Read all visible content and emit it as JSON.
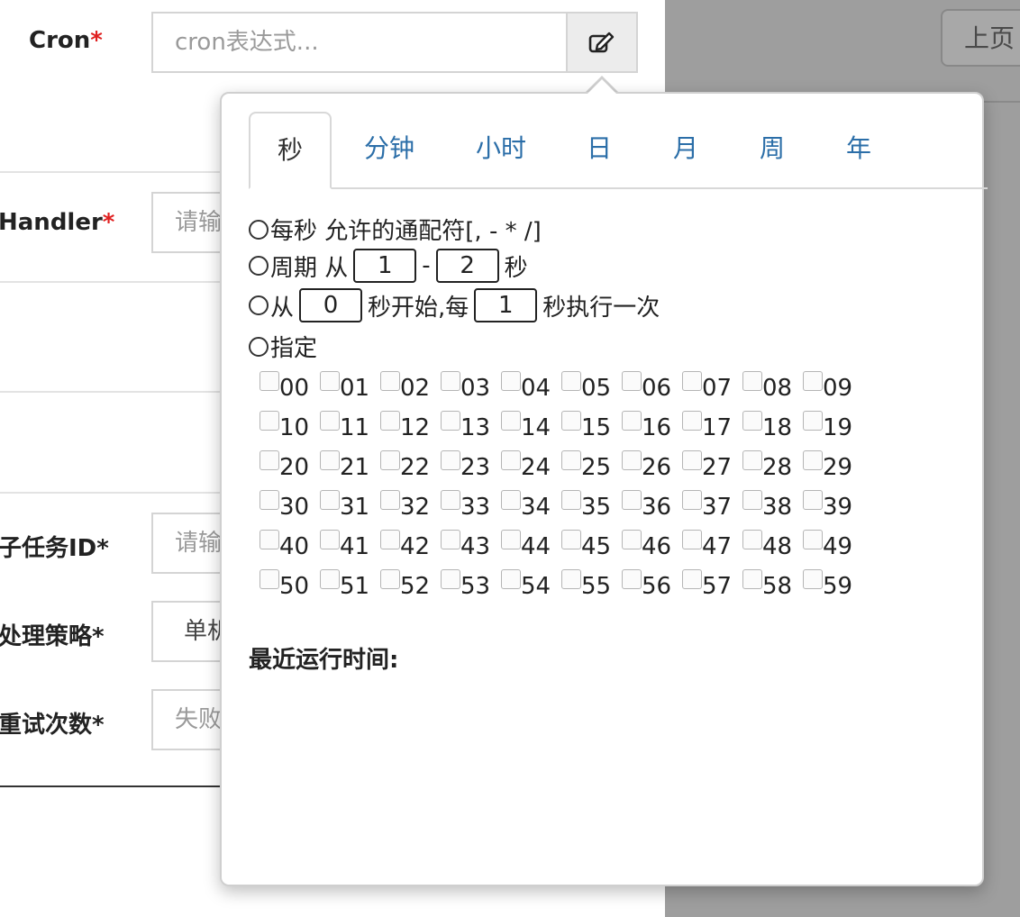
{
  "form": {
    "cron_label": "Cron",
    "cron_required": "*",
    "cron_placeholder": "cron表达式...",
    "handler_label": "Handler",
    "handler_required": "*",
    "handler_placeholder": "请输",
    "child_label": "子任务ID*",
    "child_placeholder": "请输",
    "strategy_label": "处理策略*",
    "strategy_value": "单机",
    "retry_label": "重试次数*",
    "retry_placeholder": "失败"
  },
  "backdrop": {
    "prev_page": "上页"
  },
  "cron_popover": {
    "tabs": [
      "秒",
      "分钟",
      "小时",
      "日",
      "月",
      "周",
      "年"
    ],
    "options": {
      "every": "每秒 允许的通配符[, - * /]",
      "period_prefix": "周期 从",
      "period_from": "1",
      "period_dash": "-",
      "period_to": "2",
      "period_suffix": "秒",
      "from_prefix": "从",
      "from_start": "0",
      "from_mid": "秒开始,每",
      "from_step": "1",
      "from_suffix": "秒执行一次",
      "specify": "指定"
    },
    "seconds": [
      "00",
      "01",
      "02",
      "03",
      "04",
      "05",
      "06",
      "07",
      "08",
      "09",
      "10",
      "11",
      "12",
      "13",
      "14",
      "15",
      "16",
      "17",
      "18",
      "19",
      "20",
      "21",
      "22",
      "23",
      "24",
      "25",
      "26",
      "27",
      "28",
      "29",
      "30",
      "31",
      "32",
      "33",
      "34",
      "35",
      "36",
      "37",
      "38",
      "39",
      "40",
      "41",
      "42",
      "43",
      "44",
      "45",
      "46",
      "47",
      "48",
      "49",
      "50",
      "51",
      "52",
      "53",
      "54",
      "55",
      "56",
      "57",
      "58",
      "59"
    ],
    "recent_runs_label": "最近运行时间:"
  }
}
